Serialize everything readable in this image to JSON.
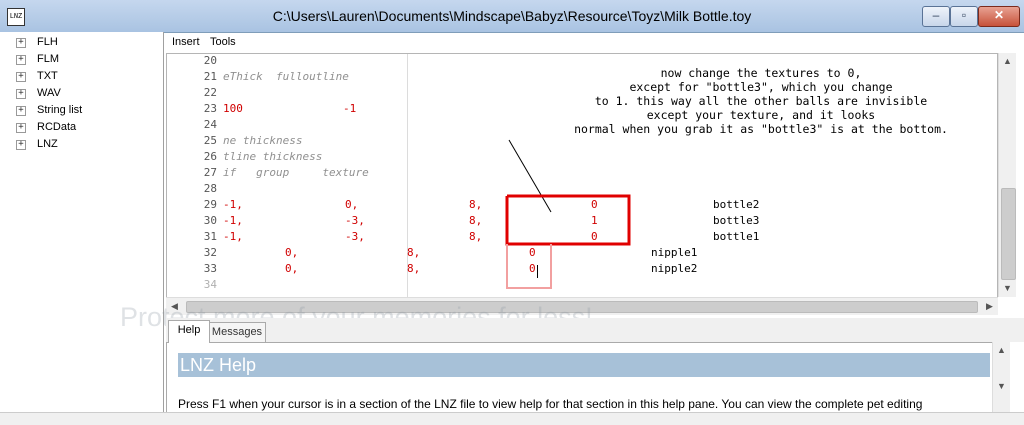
{
  "window": {
    "icon_text": "LNZ",
    "title": "C:\\Users\\Lauren\\Documents\\Mindscape\\Babyz\\Resource\\Toyz\\Milk Bottle.toy",
    "minimize": "–",
    "maximize": "▫",
    "close": "✕"
  },
  "sidebar": {
    "items": [
      {
        "expander": "+",
        "label": "FLH"
      },
      {
        "expander": "+",
        "label": "FLM"
      },
      {
        "expander": "+",
        "label": "TXT"
      },
      {
        "expander": "+",
        "label": "WAV"
      },
      {
        "expander": "+",
        "label": "String list"
      },
      {
        "expander": "+",
        "label": "RCData"
      },
      {
        "expander": "+",
        "label": "LNZ"
      }
    ]
  },
  "menu": {
    "items": [
      "Insert",
      "Tools"
    ]
  },
  "editor": {
    "lines": [
      {
        "num": "20",
        "segs": []
      },
      {
        "num": "21",
        "segs": [
          {
            "text": "eThick  fulloutline",
            "style": "gray"
          }
        ]
      },
      {
        "num": "22",
        "segs": []
      },
      {
        "num": "23",
        "segs": [
          {
            "text": "100",
            "style": "red"
          },
          {
            "text": "-1",
            "style": "red"
          }
        ]
      },
      {
        "num": "24",
        "segs": []
      },
      {
        "num": "25",
        "segs": [
          {
            "text": "ne thickness",
            "style": "gray"
          }
        ]
      },
      {
        "num": "26",
        "segs": [
          {
            "text": "tline thickness",
            "style": "gray"
          }
        ]
      },
      {
        "num": "27",
        "segs": [
          {
            "text": "if   group     texture",
            "style": "gray"
          }
        ]
      },
      {
        "num": "28",
        "segs": []
      },
      {
        "num": "29",
        "segs": [
          {
            "text": "-1,",
            "style": "red"
          },
          {
            "text": "0,",
            "style": "red"
          },
          {
            "text": "8,",
            "style": "red"
          },
          {
            "text": "0",
            "style": "red"
          },
          {
            "text": "bottle2",
            "style": "black"
          }
        ]
      },
      {
        "num": "30",
        "segs": [
          {
            "text": "-1,",
            "style": "red"
          },
          {
            "text": "-3,",
            "style": "red"
          },
          {
            "text": "8,",
            "style": "red"
          },
          {
            "text": "1",
            "style": "red"
          },
          {
            "text": "bottle3",
            "style": "black"
          }
        ]
      },
      {
        "num": "31",
        "segs": [
          {
            "text": "-1,",
            "style": "red"
          },
          {
            "text": "-3,",
            "style": "red"
          },
          {
            "text": "8,",
            "style": "red"
          },
          {
            "text": "0",
            "style": "red"
          },
          {
            "text": "bottle1",
            "style": "black"
          }
        ]
      },
      {
        "num": "32",
        "segs": [
          {
            "text": "0,",
            "style": "red"
          },
          {
            "text": "8,",
            "style": "red"
          },
          {
            "text": "0",
            "style": "red"
          },
          {
            "text": "nipple1",
            "style": "black"
          }
        ]
      },
      {
        "num": "33",
        "segs": [
          {
            "text": "0,",
            "style": "red"
          },
          {
            "text": "8,",
            "style": "red"
          },
          {
            "text": "0",
            "style": "red"
          },
          {
            "text": "nipple2",
            "style": "black"
          }
        ]
      },
      {
        "num": "34",
        "segs": []
      }
    ]
  },
  "annotation": {
    "lines": [
      "now change the textures to 0,",
      "except for \"bottle3\", which you change",
      "to 1. this way all the other balls are invisible",
      "except your texture, and it looks",
      "normal when you grab it as \"bottle3\" is at the bottom."
    ],
    "color": "#e00000"
  },
  "watermark": "Protect more of your memories for less!",
  "tabs": [
    "Help",
    "Messages"
  ],
  "help": {
    "title": "LNZ Help",
    "body": "Press F1 when your cursor is in a section of the LNZ file to view help for that section in this help pane. You can view the complete pet editing"
  },
  "scroll_icons": {
    "up": "▲",
    "down": "▼",
    "left": "◀",
    "right": "▶"
  }
}
